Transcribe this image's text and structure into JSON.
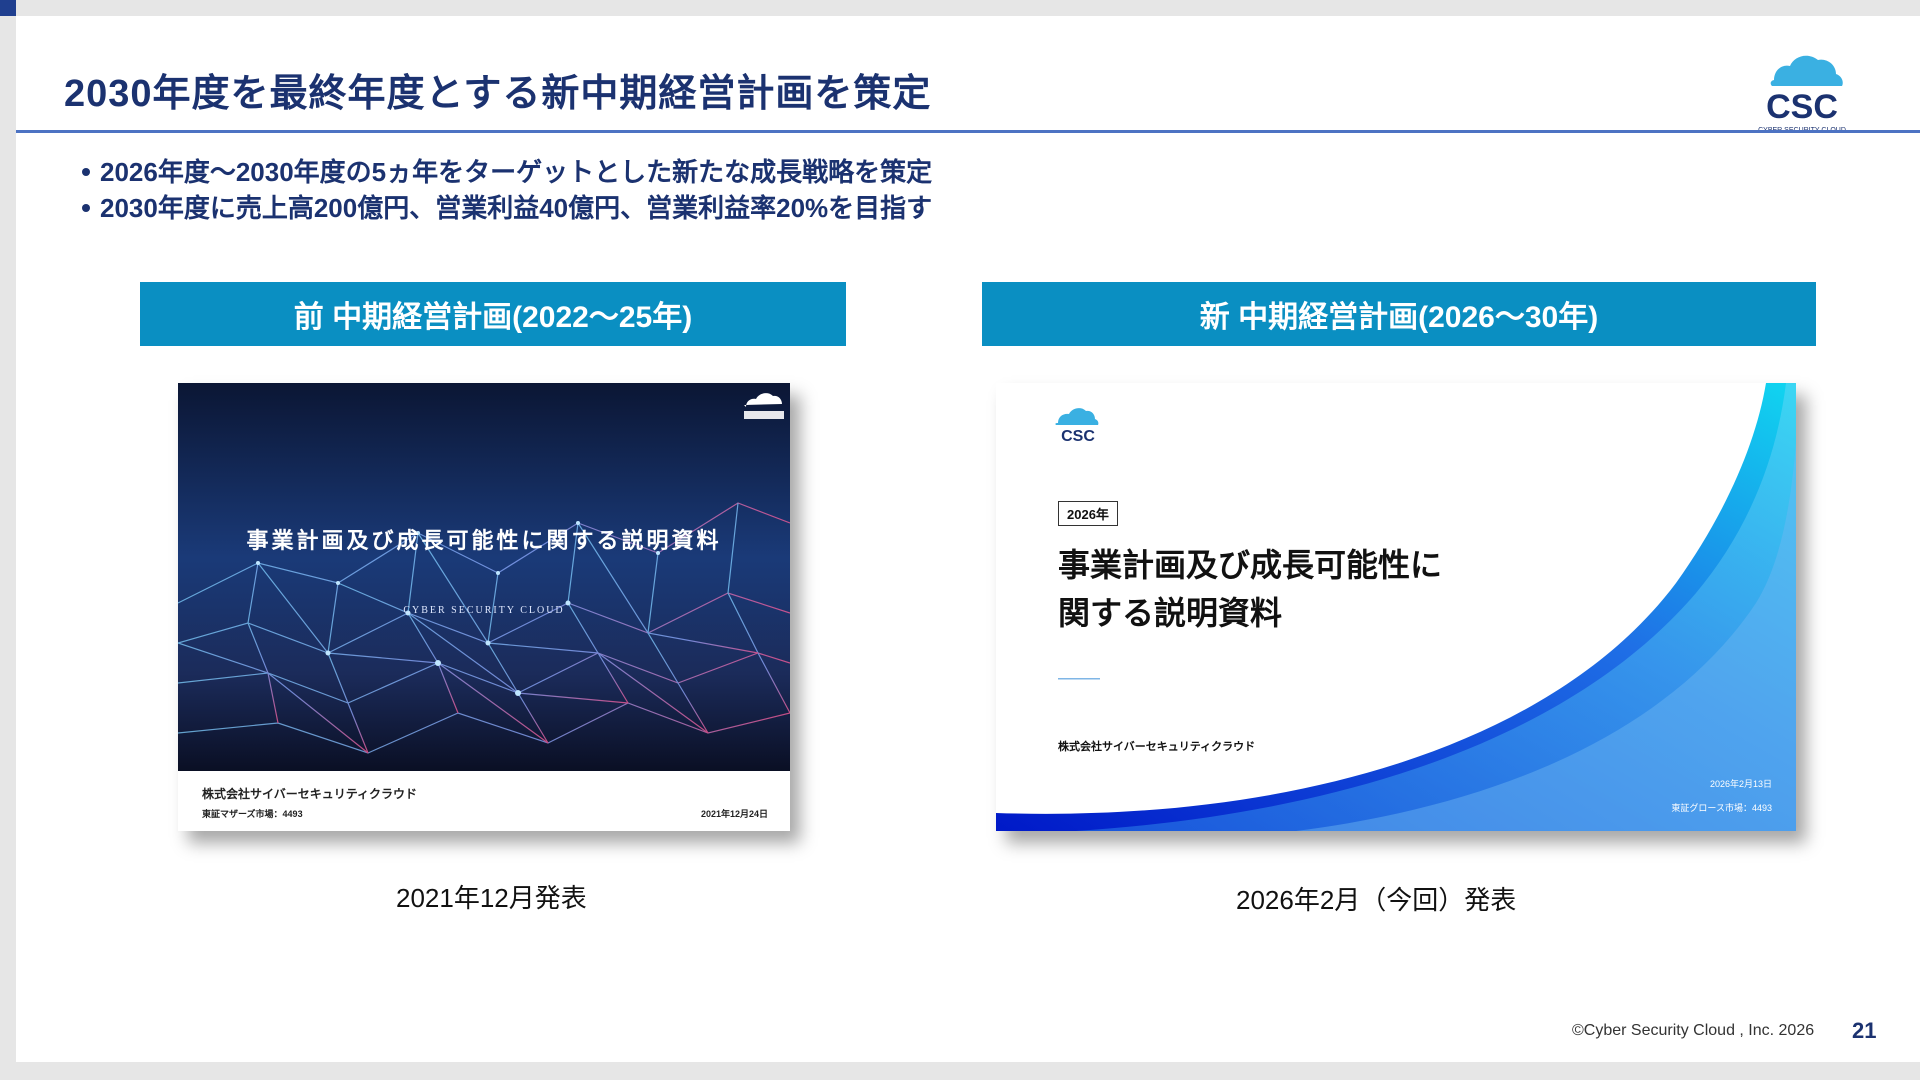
{
  "slide": {
    "title": "2030年度を最終年度とする新中期経営計画を策定",
    "bullets": [
      "2026年度～2030年度の5ヵ年をターゲットとした新たな成長戦略を策定",
      "2030年度に売上高200億円、営業利益40億円、営業利益率20%を目指す"
    ],
    "prev_plan": {
      "header": "前 中期経営計画(2022～25年)",
      "caption": "2021年12月発表",
      "thumb_title": "事業計画及び成長可能性に関する説明資料",
      "thumb_subtitle": "CYBER SECURITY CLOUD",
      "company": "株式会社サイバーセキュリティクラウド",
      "market": "東証マザーズ市場：4493",
      "date": "2021年12月24日"
    },
    "new_plan": {
      "header": "新 中期経営計画(2026～30年)",
      "caption": "2026年2月（今回）発表",
      "year_badge": "2026年",
      "thumb_title_line1": "事業計画及び成長可能性に",
      "thumb_title_line2": "関する説明資料",
      "company": "株式会社サイバーセキュリティクラウド",
      "date": "2026年2月13日",
      "market": "東証グロース市場：4493"
    },
    "logo_text": "CSC",
    "logo_sub": "CYBER SECURITY CLOUD",
    "footer": "©Cyber Security Cloud , Inc. 2026",
    "page_number": "21"
  },
  "colors": {
    "title": "#1b3270",
    "band": "#0a8fc2",
    "rule": "#4d73c3",
    "logo_cloud": "#3ab0e2",
    "logo_text": "#1b3270"
  }
}
